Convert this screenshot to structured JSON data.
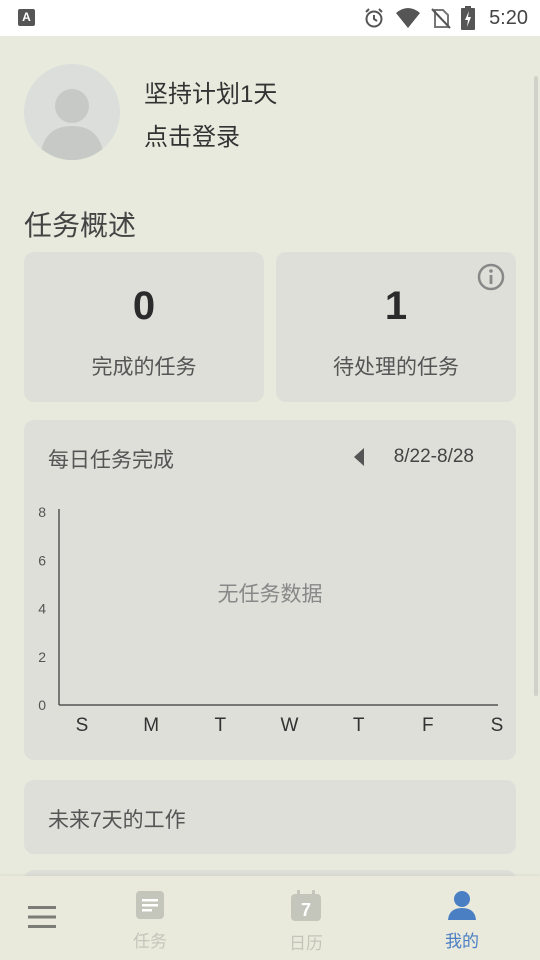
{
  "status_bar": {
    "app_badge": "A",
    "time": "5:20"
  },
  "profile": {
    "greeting": "坚持计划1天",
    "login_text": "点击登录"
  },
  "overview": {
    "title": "任务概述",
    "completed": {
      "count": "0",
      "label": "完成的任务"
    },
    "pending": {
      "count": "1",
      "label": "待处理的任务"
    }
  },
  "daily_chart": {
    "title": "每日任务完成",
    "week_range": "8/22-8/28",
    "empty_text": "无任务数据"
  },
  "chart_data": {
    "type": "bar",
    "categories": [
      "S",
      "M",
      "T",
      "W",
      "T",
      "F",
      "S"
    ],
    "values": [
      0,
      0,
      0,
      0,
      0,
      0,
      0
    ],
    "y_ticks": [
      "8",
      "6",
      "4",
      "2",
      "0"
    ],
    "ylim": [
      0,
      8
    ],
    "grid": false
  },
  "next_seven_days": {
    "title": "未来7天的工作"
  },
  "bottom_nav": {
    "items": [
      {
        "label": "",
        "icon": "menu-icon"
      },
      {
        "label": "任务",
        "icon": "task-icon"
      },
      {
        "label": "日历",
        "icon": "calendar-icon"
      },
      {
        "label": "我的",
        "icon": "profile-icon",
        "active": true
      }
    ],
    "calendar_day": "7",
    "active_color": "#4a7fc4",
    "inactive_color": "#c4c6bb"
  }
}
